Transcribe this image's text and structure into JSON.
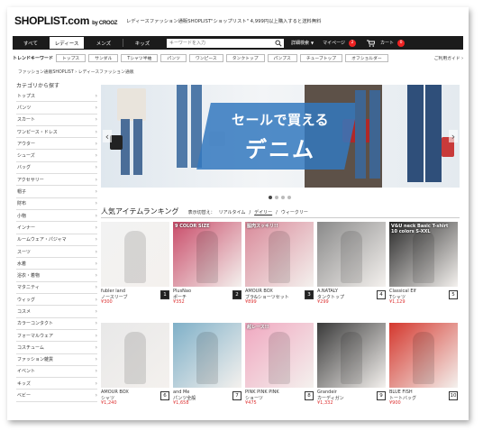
{
  "header": {
    "logo": "SHOPLIST.com",
    "logo_by": "by CROOZ",
    "tagline": "レディースファッション通販SHOPLIST\"ショップリスト\" 4,999円以上購入すると送料無料"
  },
  "nav": {
    "tabs": [
      {
        "label": "すべて",
        "active": false
      },
      {
        "label": "レディース",
        "active": true
      },
      {
        "label": "メンズ",
        "active": false
      },
      {
        "label": "キッズ",
        "active": false
      }
    ],
    "search_placeholder": "キーワードを入力",
    "advanced_search": "詳細検索",
    "mypage": "マイページ",
    "mypage_badge": "2",
    "cart": "カート",
    "cart_badge": "0"
  },
  "trend": {
    "label": "トレンドキーワード",
    "keywords": [
      "トップス",
      "サンダル",
      "Tシャツ半袖",
      "パンツ",
      "ワンピース",
      "タンクトップ",
      "パンプス",
      "チューブトップ",
      "オフショルダー"
    ],
    "guide": "ご利用ガイド"
  },
  "breadcrumb": [
    "ファッション通販SHOPLIST",
    "レディースファッション通販"
  ],
  "sidebar": {
    "title": "カテゴリから探す",
    "items": [
      "トップス",
      "パンツ",
      "スカート",
      "ワンピース・ドレス",
      "アウター",
      "シューズ",
      "バッグ",
      "アクセサリー",
      "帽子",
      "財布",
      "小物",
      "インナー",
      "ルームウェア・パジャマ",
      "スーツ",
      "水着",
      "浴衣・着物",
      "マタニティ",
      "ウィッグ",
      "コスメ",
      "カラーコンタクト",
      "フォーマルウェア",
      "コスチューム",
      "ファッション雑貨",
      "イベント",
      "キッズ",
      "ベビー"
    ]
  },
  "banner": {
    "headline_1": "セールで買える",
    "headline_2": "デニム",
    "slides": 4,
    "active_slide": 1
  },
  "ranking": {
    "title": "人気アイテムランキング",
    "switch_label": "表示切替え：",
    "modes": [
      "リアルタイム",
      "デイリー",
      "ウィークリー"
    ],
    "active_mode": "デイリー",
    "items": [
      {
        "rank": "1",
        "brand": "fubler land",
        "category": "ノースリーブ",
        "price": "¥300",
        "banner_text": "",
        "palette": "#f2f2f2"
      },
      {
        "rank": "2",
        "brand": "PlusNao",
        "category": "ポーチ",
        "price": "¥352",
        "banner_text": "9 COLOR SIZE",
        "palette": "#c94d6a"
      },
      {
        "rank": "3",
        "brand": "AMOUR BOX",
        "category": "ブラ&ショーツセット",
        "price": "¥899",
        "banner_text": "脇肉スッキリ!!",
        "palette": "#d98a9a"
      },
      {
        "rank": "4",
        "brand": "A.NATALY",
        "category": "タンクトップ",
        "price": "¥299",
        "banner_text": "",
        "palette": "#8a8a8a"
      },
      {
        "rank": "5",
        "brand": "Classical Elf",
        "category": "Tシャツ",
        "price": "¥1,129",
        "banner_text": "V&U neck Basic T-shirt 10 colors S-XXL",
        "palette": "#2a2a2a"
      },
      {
        "rank": "6",
        "brand": "AMOUR BOX",
        "category": "シャツ",
        "price": "¥1,240",
        "banner_text": "",
        "palette": "#e8e8e8"
      },
      {
        "rank": "7",
        "brand": "and Me",
        "category": "パンツ全般",
        "price": "¥1,658",
        "banner_text": "",
        "palette": "#7fb0c8"
      },
      {
        "rank": "8",
        "brand": "PINK PINK PINK",
        "category": "ショーツ",
        "price": "¥475",
        "banner_text": "超レース!!",
        "palette": "#f0a8c0"
      },
      {
        "rank": "9",
        "brand": "Grandeir",
        "category": "カーディガン",
        "price": "¥1,332",
        "banner_text": "",
        "palette": "#3a3a3a"
      },
      {
        "rank": "10",
        "brand": "BLUE FISH",
        "category": "トートバッグ",
        "price": "¥900",
        "banner_text": "",
        "palette": "#d4382e"
      }
    ]
  }
}
